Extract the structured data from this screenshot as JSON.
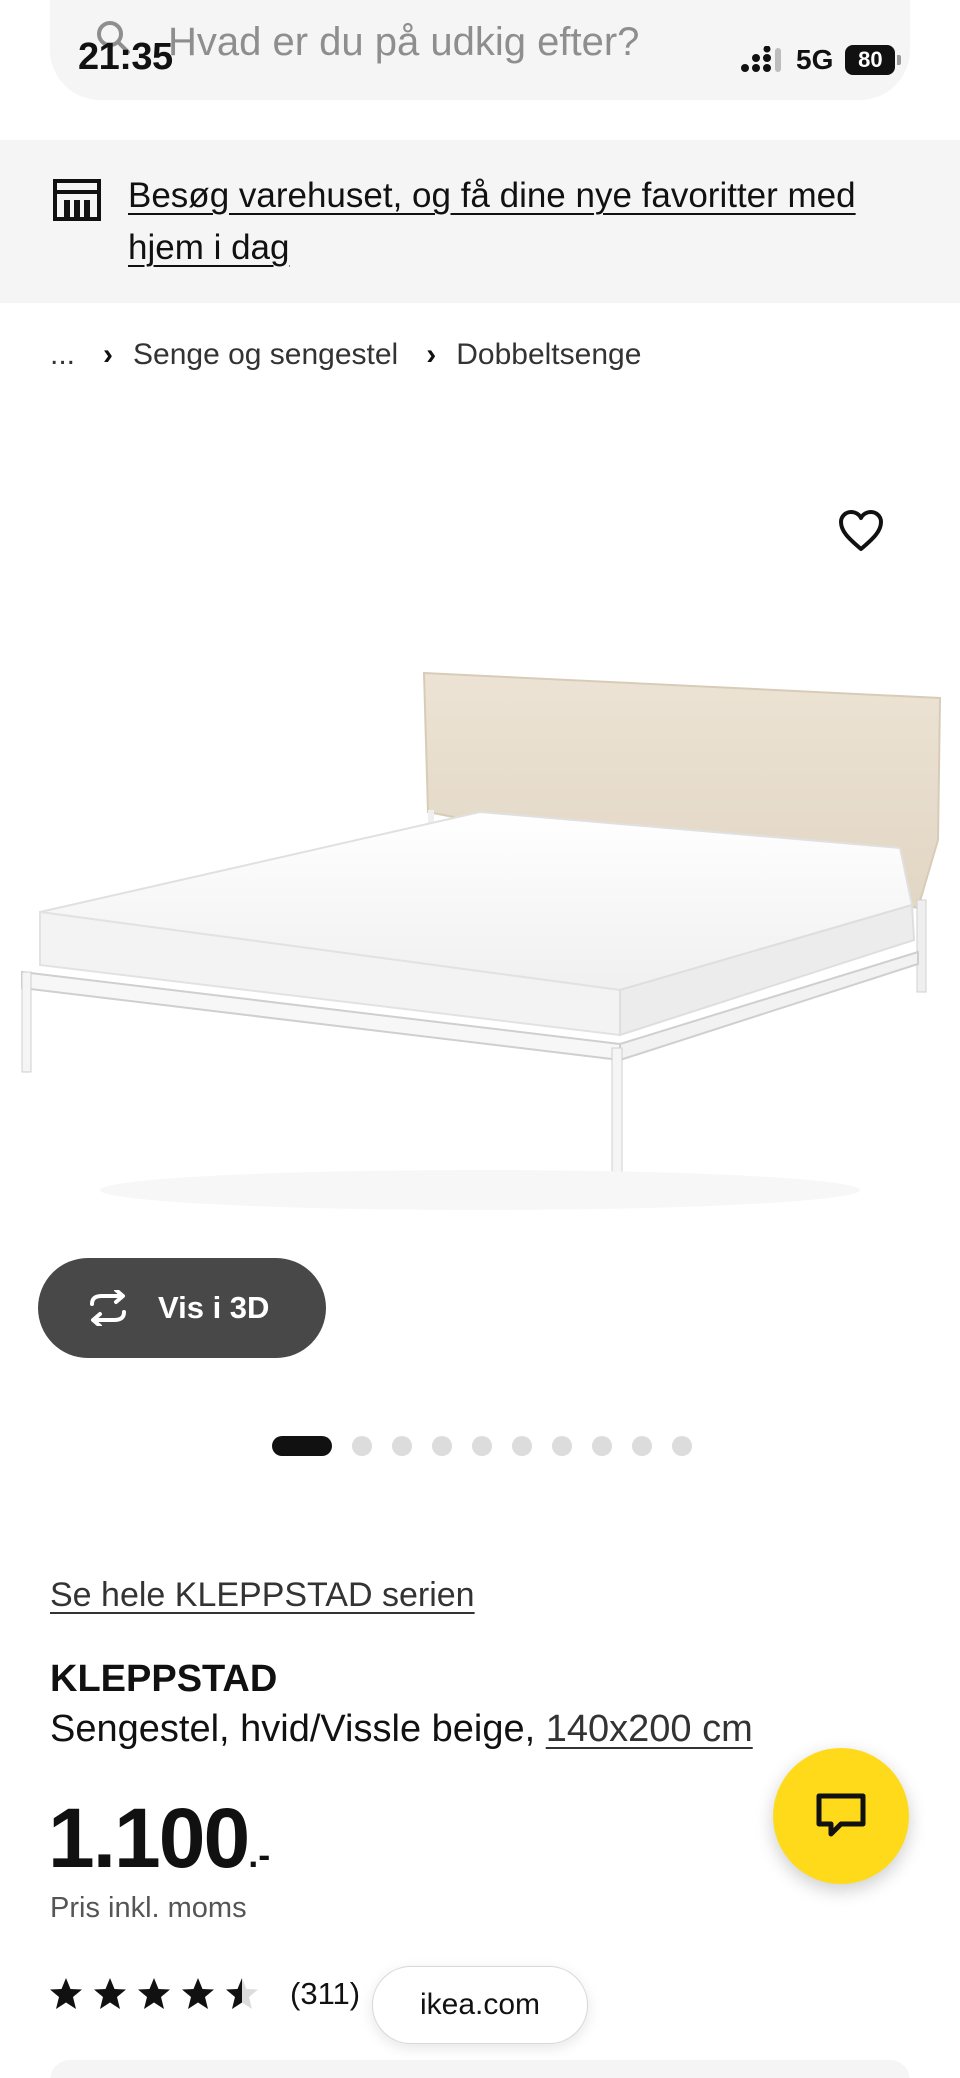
{
  "status_bar": {
    "time": "21:35",
    "network": "5G",
    "battery": "80"
  },
  "search": {
    "placeholder": "Hvad er du på udkig efter?"
  },
  "store_banner": {
    "text": "Besøg varehuset, og få dine nye favoritter med hjem i dag"
  },
  "breadcrumb": {
    "ellipsis": "...",
    "items": [
      "Senge og sengestel",
      "Dobbeltsenge"
    ]
  },
  "gallery": {
    "view_3d_label": "Vis i 3D",
    "image_count": 10,
    "active_index": 0
  },
  "product": {
    "series_link": "Se hele KLEPPSTAD serien",
    "name": "KLEPPSTAD",
    "description": "Sengestel, hvid/Vissle beige,",
    "size": "140x200 cm",
    "price": "1.100",
    "price_suffix": ".-",
    "price_note": "Pris inkl. moms",
    "rating": 4.5,
    "rating_count": "(311)"
  },
  "browser": {
    "domain": "ikea.com"
  },
  "colors": {
    "accent_yellow": "#ffda1a",
    "dark_button": "#484848",
    "banner_bg": "#f5f5f5"
  },
  "icons": {
    "search": "search-icon",
    "store": "store-icon",
    "favorite": "heart-icon",
    "view_3d": "rotate-3d-icon",
    "chat": "chat-icon",
    "star": "star-icon"
  }
}
